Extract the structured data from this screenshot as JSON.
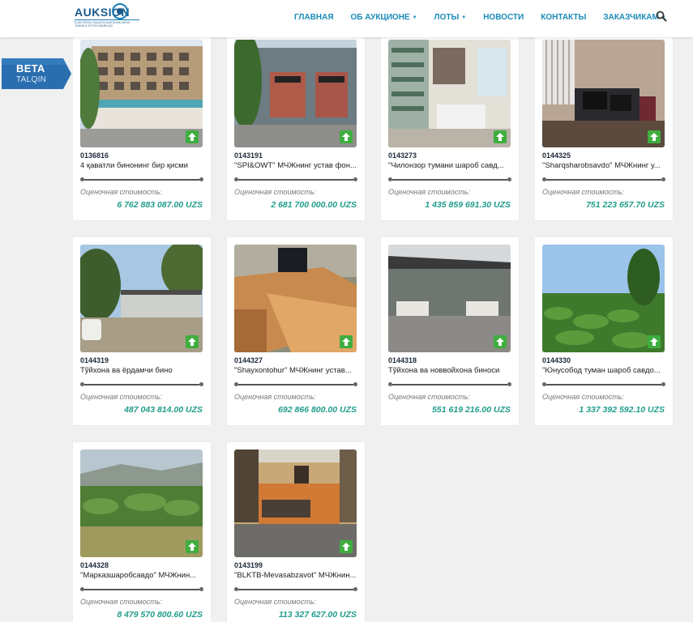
{
  "header": {
    "logo_word": "AUKSION",
    "logo_sub": "ELEKTRON ONLAYN AUKSIONLARNI\nTASHKIL ETISH MARKAZI",
    "nav": [
      {
        "label": "ГЛАВНАЯ",
        "dropdown": false
      },
      {
        "label": "ОБ АУКЦИОНЕ",
        "dropdown": true
      },
      {
        "label": "ЛОТЫ",
        "dropdown": true
      },
      {
        "label": "НОВОСТИ",
        "dropdown": false
      },
      {
        "label": "КОНТАКТЫ",
        "dropdown": false
      },
      {
        "label": "ЗАКАЗЧИКАМ",
        "dropdown": true
      }
    ],
    "search_icon": "search-icon"
  },
  "beta_badge": {
    "title": "BETA",
    "subtitle": "TALQIN"
  },
  "estimate_label": "Оценочная стоимость:",
  "lots": [
    {
      "code": "0136816",
      "title": "4 қаватли бинонинг бир қисми",
      "price": "6 762 883 087.00 UZS",
      "photo": "building"
    },
    {
      "code": "0143191",
      "title": "\"SPI&OWT\" МЧЖнинг устав фон...",
      "price": "2 681 700 000.00 UZS",
      "photo": "shopfront"
    },
    {
      "code": "0143273",
      "title": "\"Чилонзор тумани шароб савд...",
      "price": "1 435 859 691.30 UZS",
      "photo": "store"
    },
    {
      "code": "0144325",
      "title": "\"Sharqsharobsavdo\" МЧЖнинг у...",
      "price": "751 223 657.70 UZS",
      "photo": "office"
    },
    {
      "code": "0144319",
      "title": "Тўйхона ва ёрдамчи бино",
      "price": "487 043 814.00 UZS",
      "photo": "yard"
    },
    {
      "code": "0144327",
      "title": "\"Shayxontohur\" МЧЖнинг устав...",
      "price": "692 866 800.00 UZS",
      "photo": "desk"
    },
    {
      "code": "0144318",
      "title": "Тўйхона ва новвойхона биноси",
      "price": "551 619 216.00 UZS",
      "photo": "shed"
    },
    {
      "code": "0144330",
      "title": "\"Юнусобод туман шароб савдо...",
      "price": "1 337 392 592.10 UZS",
      "photo": "vineyard"
    },
    {
      "code": "0144328",
      "title": "\"Марказшаробсавдо\" МЧЖнин...",
      "price": "8 479 570 800.60 UZS",
      "photo": "field"
    },
    {
      "code": "0143199",
      "title": "\"BLKTB-Mevasabzavot\" МЧЖнин...",
      "price": "113 327 627.00 UZS",
      "photo": "room"
    }
  ]
}
